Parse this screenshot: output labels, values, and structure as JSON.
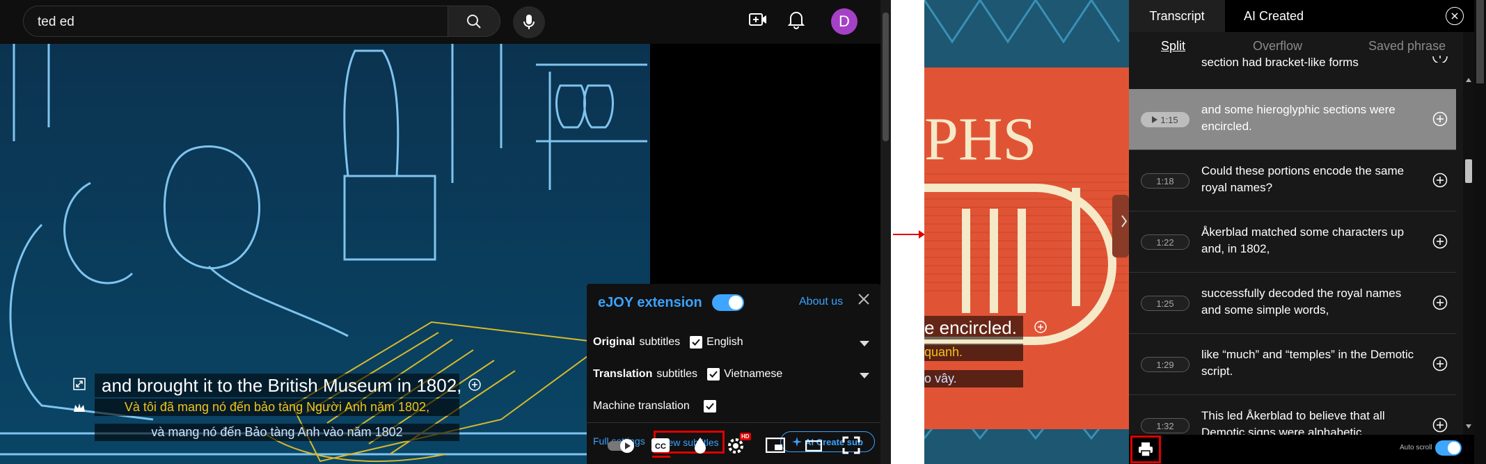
{
  "search": {
    "query": "ted ed"
  },
  "header": {
    "avatar_letter": "D"
  },
  "subtitles": {
    "original": "and brought it to the British Museum in 1802,",
    "translation_1": "Và tôi đã mang nó đến bảo tàng Người Anh năm 1802,",
    "translation_2": "và mang nó đến Bảo tàng Anh vào năm 1802"
  },
  "ejoy": {
    "title": "eJOY extension",
    "about": "About us",
    "original_label_bold": "Original",
    "original_label_rest": "subtitles",
    "original_lang": "English",
    "translation_label_bold": "Translation",
    "translation_label_rest": "subtitles",
    "translation_lang": "Vietnamese",
    "machine_translation": "Machine translation",
    "full_settings": "Full settings",
    "view_subtitles": "View subtitles",
    "ai_create_sub": "AI Create sub"
  },
  "player": {
    "hd_badge": "HD"
  },
  "right_video": {
    "title_partial": "PHS",
    "sub_original": "e encircled.",
    "sub_tr1": "quanh.",
    "sub_tr2": "o vây."
  },
  "panel": {
    "tabs": [
      "Transcript",
      "AI Created"
    ],
    "subtabs": [
      "Split",
      "Overflow",
      "Saved phrase"
    ],
    "partial_top": "section had bracket-like forms",
    "rows": [
      {
        "time": "1:15",
        "text": "and some hieroglyphic sections were encircled.",
        "active": true
      },
      {
        "time": "1:18",
        "text": "Could these portions encode the same royal names?",
        "active": false
      },
      {
        "time": "1:22",
        "text": "Åkerblad matched some characters up and, in 1802,",
        "active": false
      },
      {
        "time": "1:25",
        "text": "successfully decoded the royal names and some simple words,",
        "active": false
      },
      {
        "time": "1:29",
        "text": "like “much” and “temples” in the Demotic script.",
        "active": false
      },
      {
        "time": "1:32",
        "text": "This led Åkerblad to believe that all Demotic signs were alphabetic",
        "active": false
      }
    ],
    "autoscroll": "Auto scroll"
  }
}
